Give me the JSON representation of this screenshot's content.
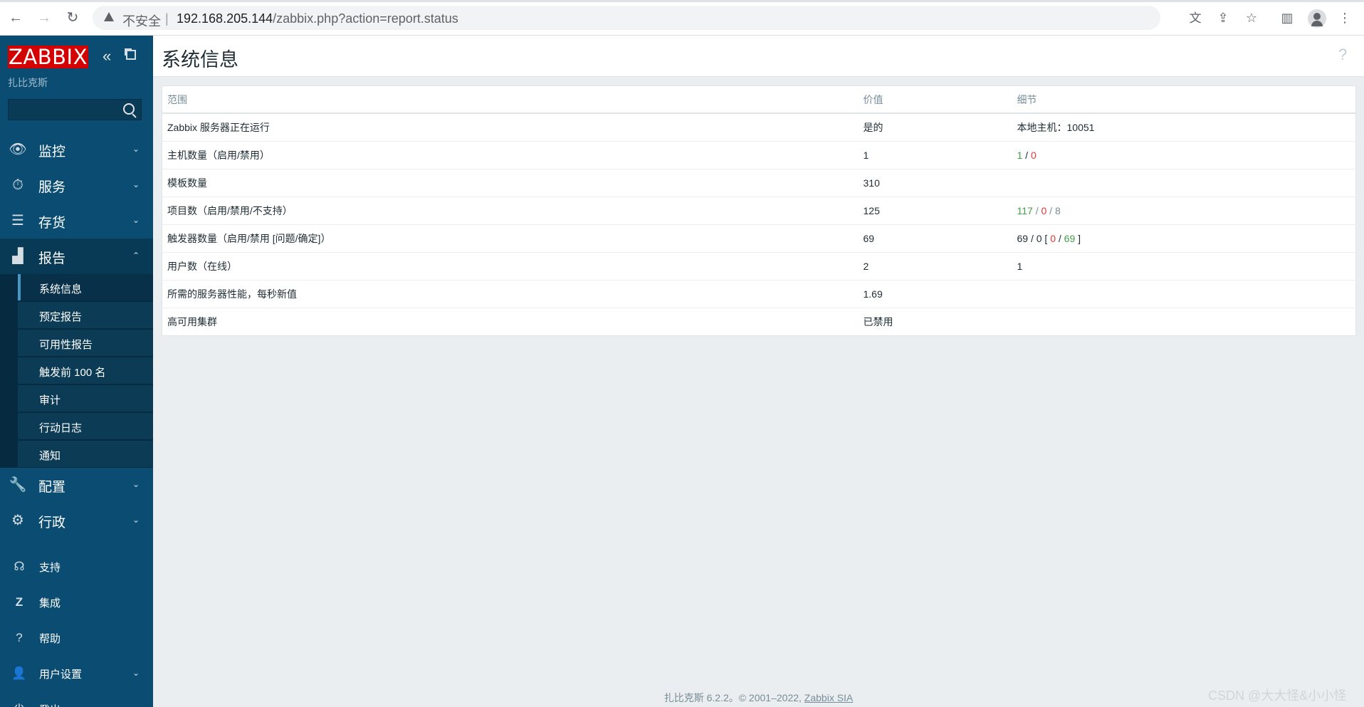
{
  "browser": {
    "insecure_label": "不安全",
    "separator": "|",
    "url_host": "192.168.205.144",
    "url_path": "/zabbix.php?action=report.status"
  },
  "sidebar": {
    "logo": "ZABBIX",
    "server_name": "扎比克斯",
    "search_value": "",
    "menu": {
      "monitoring": "监控",
      "services": "服务",
      "inventory": "存货",
      "reports": "报告",
      "configuration": "配置",
      "administration": "行政"
    },
    "reports_sub": [
      "系统信息",
      "预定报告",
      "可用性报告",
      "触发前 100 名",
      "审计",
      "行动日志",
      "通知"
    ],
    "bottom": {
      "support": "支持",
      "integrations": "集成",
      "help": "帮助",
      "user_settings": "用户设置",
      "sign_out": "登出"
    }
  },
  "page": {
    "title": "系统信息",
    "help": "?"
  },
  "table": {
    "headers": [
      "范围",
      "价值",
      "细节"
    ],
    "rows": [
      {
        "param": "Zabbix 服务器正在运行",
        "value": "是的",
        "details": "本地主机：10051"
      },
      {
        "param": "主机数量（启用/禁用）",
        "value": "1",
        "d1": "1",
        "s1": " / ",
        "d2": "0"
      },
      {
        "param": "模板数量",
        "value": "310"
      },
      {
        "param": "项目数（启用/禁用/不支持）",
        "value": "125",
        "d1": "117",
        "s1": " / ",
        "d2": "0",
        "s2": " / ",
        "d3": "8"
      },
      {
        "param": "触发器数量（启用/禁用 [问题/确定]）",
        "value": "69",
        "d0": "69 / 0 [ ",
        "d1": "0",
        "s1": " / ",
        "d2": "69",
        "s2": " ]"
      },
      {
        "param": "用户数（在线）",
        "value": "2",
        "d1": "1"
      },
      {
        "param": "所需的服务器性能，每秒新值",
        "value": "1.69"
      },
      {
        "param": "高可用集群",
        "value": "已禁用"
      }
    ]
  },
  "footer": {
    "text": "扎比克斯 6.2.2。© 2001–2022, ",
    "link": "Zabbix SIA"
  },
  "watermark": "CSDN @大大怪&小小怪",
  "colors": {
    "sidebar": "#0b4d72",
    "logo": "#d40000",
    "ok": "#429e47",
    "problem": "#e33734"
  }
}
